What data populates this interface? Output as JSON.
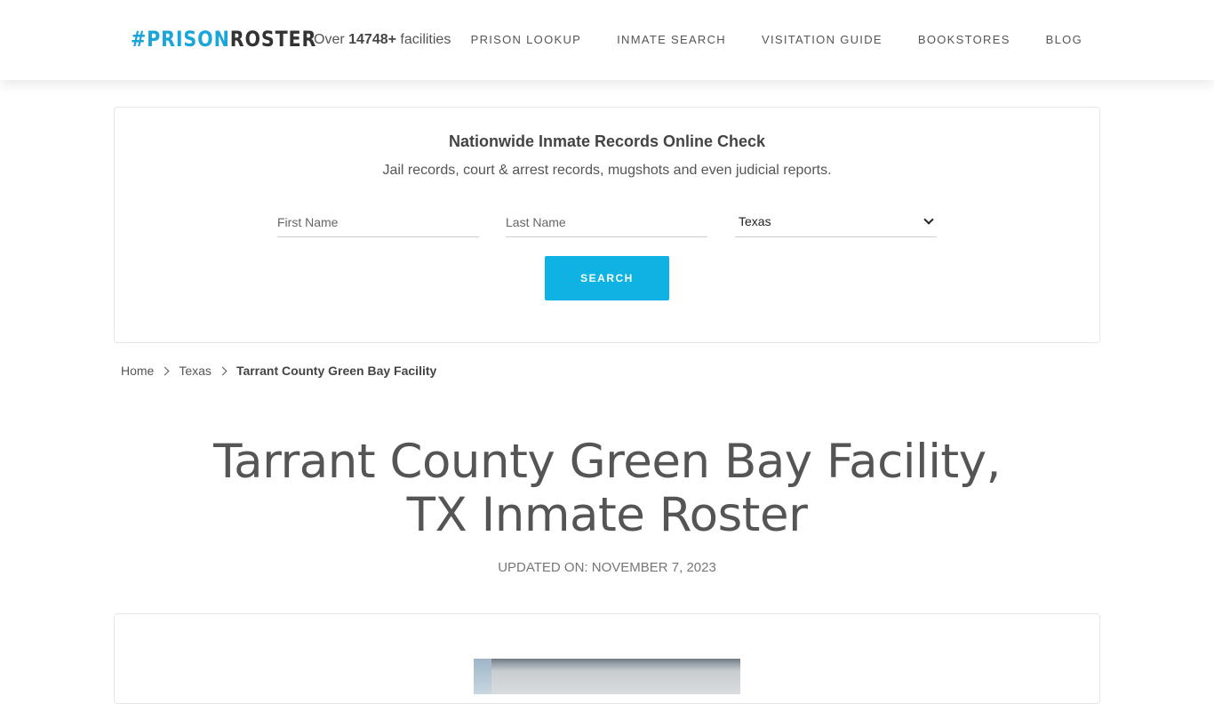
{
  "header": {
    "logo": {
      "hash": "#",
      "word1": "PRISON",
      "word2": "ROSTER"
    },
    "facilities": {
      "prefix": "Over ",
      "count": "14748+",
      "suffix": " facilities"
    },
    "nav": [
      {
        "label": "PRISON LOOKUP"
      },
      {
        "label": "INMATE SEARCH"
      },
      {
        "label": "VISITATION GUIDE"
      },
      {
        "label": "BOOKSTORES"
      },
      {
        "label": "BLOG"
      }
    ]
  },
  "search": {
    "title": "Nationwide Inmate Records Online Check",
    "subtitle": "Jail records, court & arrest records, mugshots and even judicial reports.",
    "first_name_placeholder": "First Name",
    "last_name_placeholder": "Last Name",
    "state_selected": "Texas",
    "button_label": "SEARCH"
  },
  "breadcrumb": [
    {
      "label": "Home"
    },
    {
      "label": "Texas"
    },
    {
      "label": "Tarrant County Green Bay Facility"
    }
  ],
  "page": {
    "title_line1": "Tarrant County Green Bay Facility,",
    "title_line2": "TX Inmate Roster",
    "updated": "UPDATED ON: NOVEMBER 7, 2023"
  },
  "colors": {
    "accent": "#0fb3e3",
    "logo_blue": "#1aa6d9",
    "text": "#555555"
  }
}
